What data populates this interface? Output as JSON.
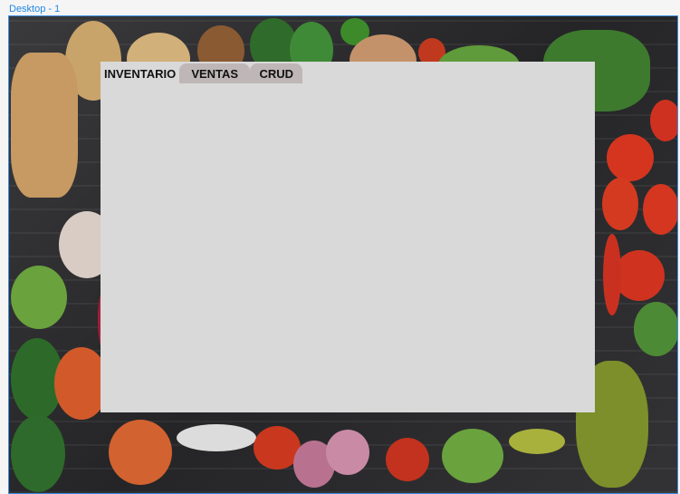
{
  "frame": {
    "label": "Desktop - 1"
  },
  "tabs": [
    {
      "label": "INVENTARIO",
      "active": true
    },
    {
      "label": "VENTAS",
      "active": false
    },
    {
      "label": "CRUD",
      "active": false
    }
  ],
  "colors": {
    "accent": "#1e88e5",
    "panel": "#d9d9d9",
    "tab_inactive": "#bfb7b7"
  }
}
